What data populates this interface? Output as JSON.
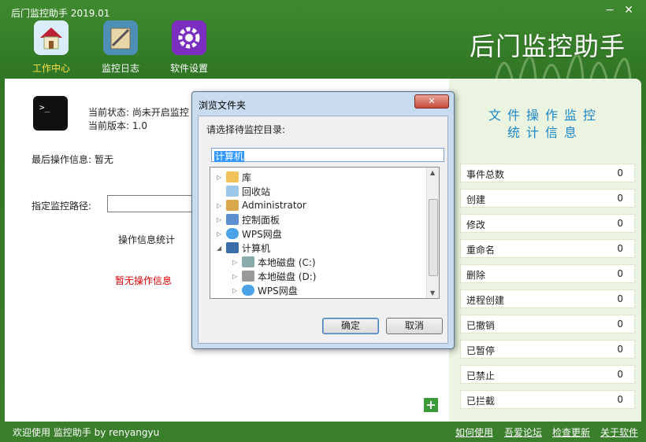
{
  "window": {
    "title": "后门监控助手 2019.01",
    "min_label": "−",
    "close_label": "✕"
  },
  "brand": "后门监控助手",
  "nav": [
    {
      "label": "工作中心",
      "icon": "house-icon",
      "active": true
    },
    {
      "label": "监控日志",
      "icon": "notebook-icon",
      "active": false
    },
    {
      "label": "软件设置",
      "icon": "gear-icon",
      "active": false
    }
  ],
  "status": {
    "state_label": "当前状态:",
    "state_value": "尚未开启监控",
    "version_label": "当前版本:",
    "version_value": "1.0",
    "last_op_label": "最后操作信息:",
    "last_op_value": "暂无",
    "path_label": "指定监控路径:"
  },
  "stats_panel": {
    "title": "操作信息统计",
    "empty": "暂无操作信息"
  },
  "right": {
    "title_line1": "文件操作监控",
    "title_line2": "统计信息",
    "rows": [
      {
        "label": "事件总数",
        "value": "0"
      },
      {
        "label": "创建",
        "value": "0"
      },
      {
        "label": "修改",
        "value": "0"
      },
      {
        "label": "重命名",
        "value": "0"
      },
      {
        "label": "删除",
        "value": "0"
      },
      {
        "label": "进程创建",
        "value": "0"
      },
      {
        "label": "已撤销",
        "value": "0"
      },
      {
        "label": "已暂停",
        "value": "0"
      },
      {
        "label": "已禁止",
        "value": "0"
      },
      {
        "label": "已拦截",
        "value": "0"
      }
    ]
  },
  "statusbar": {
    "welcome": "欢迎使用 监控助手  by  renyangyu",
    "links": [
      "如何使用",
      "吾爱论坛",
      "检查更新",
      "关于软件"
    ]
  },
  "dialog": {
    "title": "浏览文件夹",
    "close": "✕",
    "prompt": "请选择待监控目录:",
    "selected": "计算机",
    "tree": [
      {
        "label": "库",
        "indent": 0,
        "arrow": "▷",
        "icon": "library-icon"
      },
      {
        "label": "回收站",
        "indent": 0,
        "arrow": "",
        "icon": "recycle-bin-icon"
      },
      {
        "label": "Administrator",
        "indent": 0,
        "arrow": "▷",
        "icon": "user-folder-icon"
      },
      {
        "label": "控制面板",
        "indent": 0,
        "arrow": "▷",
        "icon": "control-panel-icon"
      },
      {
        "label": "WPS网盘",
        "indent": 0,
        "arrow": "▷",
        "icon": "cloud-icon"
      },
      {
        "label": "计算机",
        "indent": 0,
        "arrow": "◢",
        "icon": "computer-icon"
      },
      {
        "label": "本地磁盘 (C:)",
        "indent": 1,
        "arrow": "▷",
        "icon": "windows-drive-icon"
      },
      {
        "label": "本地磁盘 (D:)",
        "indent": 1,
        "arrow": "▷",
        "icon": "drive-icon"
      },
      {
        "label": "WPS网盘",
        "indent": 1,
        "arrow": "▷",
        "icon": "cloud-icon"
      }
    ],
    "ok": "确定",
    "cancel": "取消"
  }
}
